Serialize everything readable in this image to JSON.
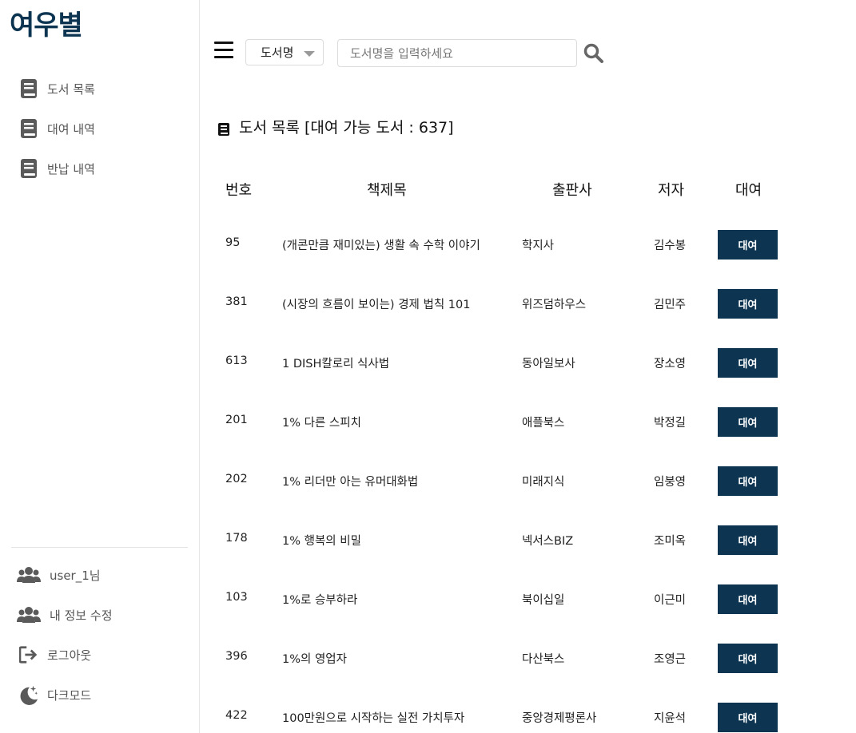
{
  "logo": "여우별",
  "sidebar": {
    "nav": [
      {
        "label": "도서 목록",
        "icon": "book-icon"
      },
      {
        "label": "대여 내역",
        "icon": "book-icon"
      },
      {
        "label": "반납 내역",
        "icon": "book-icon"
      }
    ],
    "bottom": [
      {
        "label": "user_1님",
        "icon": "users-icon"
      },
      {
        "label": "내 정보 수정",
        "icon": "users-icon"
      },
      {
        "label": "로그아웃",
        "icon": "logout-icon"
      },
      {
        "label": "다크모드",
        "icon": "moon-icon"
      }
    ]
  },
  "search": {
    "category": "도서명",
    "placeholder": "도서명을 입력하세요",
    "value": ""
  },
  "page_title": "도서 목록 [대여 가능 도서 : 637]",
  "table": {
    "headers": [
      "번호",
      "책제목",
      "출판사",
      "저자",
      "대여"
    ],
    "rows": [
      {
        "no": "95",
        "title": "(개콘만큼 재미있는) 생활 속 수학 이야기",
        "publisher": "학지사",
        "author": "김수봉",
        "action": "대여"
      },
      {
        "no": "381",
        "title": "(시장의 흐름이 보이는) 경제 법칙 101",
        "publisher": "위즈덤하우스",
        "author": "김민주",
        "action": "대여"
      },
      {
        "no": "613",
        "title": "1 DISH칼로리 식사법",
        "publisher": "동아일보사",
        "author": "장소영",
        "action": "대여"
      },
      {
        "no": "201",
        "title": "1% 다른 스피치",
        "publisher": "애플북스",
        "author": "박정길",
        "action": "대여"
      },
      {
        "no": "202",
        "title": "1% 리더만 아는 유머대화법",
        "publisher": "미래지식",
        "author": "임붕영",
        "action": "대여"
      },
      {
        "no": "178",
        "title": "1% 행복의 비밀",
        "publisher": "넥서스BIZ",
        "author": "조미옥",
        "action": "대여"
      },
      {
        "no": "103",
        "title": "1%로 승부하라",
        "publisher": "북이십일",
        "author": "이근미",
        "action": "대여"
      },
      {
        "no": "396",
        "title": "1%의 영업자",
        "publisher": "다산북스",
        "author": "조영근",
        "action": "대여"
      },
      {
        "no": "422",
        "title": "100만원으로 시작하는 실전 가치투자",
        "publisher": "중앙경제평론사",
        "author": "지윤석",
        "action": "대여"
      }
    ]
  },
  "colors": {
    "brand": "#0d3552",
    "icon": "#555555"
  }
}
